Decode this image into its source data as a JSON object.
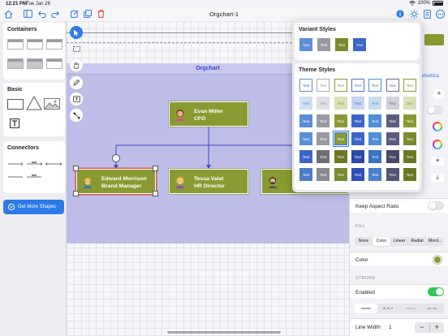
{
  "status_bar": {
    "time": "12:21 PM",
    "date": "Tue Jan 26",
    "battery": "100%"
  },
  "document": {
    "title": "Orgchart-1"
  },
  "left_panel": {
    "containers_title": "Containers",
    "basic_title": "Basic",
    "connectors_title": "Connectors",
    "get_more_label": "Get More Shapes"
  },
  "orgchart": {
    "title": "Orgchart",
    "nodes": [
      {
        "name": "Evan Miller",
        "role": "CFO"
      },
      {
        "name": "Edward Morrison",
        "role": "Brand Manager"
      },
      {
        "name": "Tessa Valet",
        "role": "HR Director"
      }
    ]
  },
  "popover": {
    "variant_title": "Variant Styles",
    "theme_title": "Theme Styles",
    "swatch_text": "Text",
    "variant_colors": [
      "#5b8ed8",
      "#9a9aa2",
      "#7a8a2e",
      "#3d64c8"
    ],
    "theme_rows": [
      {
        "fills": [
          "#ffffff",
          "#ffffff",
          "#ffffff",
          "#ffffff",
          "#ffffff",
          "#ffffff",
          "#ffffff"
        ],
        "borders": [
          "#5b8ed8",
          "#b0b0b8",
          "#8a9a32",
          "#4a6fd0",
          "#4d8fd8",
          "#6a6a90",
          "#8a9a32"
        ],
        "text": [
          "#3d64c8",
          "#8a8a90",
          "#7a8a2e",
          "#3d64c8",
          "#3d64c8",
          "#5a5a78",
          "#7a8a2e"
        ]
      },
      {
        "fills": [
          "#cfe0f6",
          "#e0e0e4",
          "#d9e0b8",
          "#c8d4f0",
          "#c8dcf0",
          "#d0d0dc",
          "#d9e0b8"
        ],
        "borders": [
          "#cfe0f6",
          "#e0e0e4",
          "#d9e0b8",
          "#c8d4f0",
          "#c8dcf0",
          "#d0d0dc",
          "#d9e0b8"
        ],
        "text": [
          "#5b8ed8",
          "#9a9aa2",
          "#8a9a32",
          "#4a6fd0",
          "#4d8fd8",
          "#6a6a90",
          "#8a9a32"
        ]
      },
      {
        "fills": [
          "#5b8ed8",
          "#9a9aa2",
          "#8a9a32",
          "#3d64c8",
          "#4d8fd8",
          "#5c5c80",
          "#8a9a32"
        ],
        "borders": [
          "#5b8ed8",
          "#9a9aa2",
          "#8a9a32",
          "#3d64c8",
          "#4d8fd8",
          "#5c5c80",
          "#8a9a32"
        ],
        "text": [
          "#ffffff",
          "#ffffff",
          "#ffffff",
          "#ffffff",
          "#ffffff",
          "#ffffff",
          "#ffffff"
        ]
      },
      {
        "fills": [
          "#5b8ed8",
          "#9a9aa2",
          "#8a9a32",
          "#3d64c8",
          "#4d8fd8",
          "#5c5c80",
          "#7a8a2e"
        ],
        "borders": [
          "#5b8ed8",
          "#9a9aa2",
          "#2c7be5",
          "#3d64c8",
          "#4d8fd8",
          "#5c5c80",
          "#7a8a2e"
        ],
        "text": [
          "#ffffff",
          "#ffffff",
          "#ffffff",
          "#ffffff",
          "#ffffff",
          "#ffffff",
          "#ffffff"
        ]
      },
      {
        "fills": [
          "#3d64c8",
          "#6e6e76",
          "#6a7826",
          "#2a48a8",
          "#3a72c0",
          "#484868",
          "#6a7826"
        ],
        "borders": [
          "#3d64c8",
          "#6e6e76",
          "#6a7826",
          "#2a48a8",
          "#3a72c0",
          "#484868",
          "#6a7826"
        ],
        "text": [
          "#ffffff",
          "#ffffff",
          "#ffffff",
          "#ffffff",
          "#ffffff",
          "#ffffff",
          "#ffffff"
        ]
      },
      {
        "fills": [
          "#4d7cc8",
          "#8a8a92",
          "#7a8a2e",
          "#3050b8",
          "#4a80c8",
          "#545478",
          "#6a7826"
        ],
        "borders": [
          "#4d7cc8",
          "#8a8a92",
          "#7a8a2e",
          "#3050b8",
          "#4a80c8",
          "#545478",
          "#6a7826"
        ],
        "text": [
          "#ffffff",
          "#ffffff",
          "#ffffff",
          "#ffffff",
          "#ffffff",
          "#ffffff",
          "#ffffff"
        ]
      }
    ],
    "selected": {
      "row": 3,
      "col": 2
    }
  },
  "right_panel": {
    "font_partial": "elvetica",
    "keep_aspect_label": "Keep Aspect Ratio",
    "fill_label": "FILL",
    "fill_modes": [
      "None",
      "Color",
      "Linear",
      "Radial",
      "Mord..."
    ],
    "color_label": "Color",
    "color_value": "#8a9a32",
    "stroke_label": "STROKE",
    "enabled_label": "Enabled",
    "line_width_label": "Line Width",
    "line_width_value": "1"
  }
}
